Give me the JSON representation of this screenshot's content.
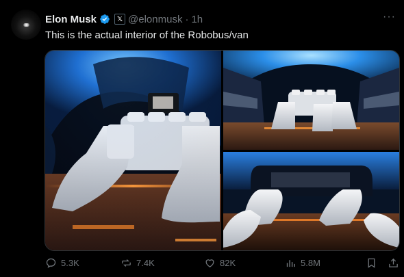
{
  "tweet": {
    "author": {
      "name": "Elon Musk",
      "handle": "@elonmusk",
      "x_badge": "𝕏",
      "separator": "·",
      "time": "1h"
    },
    "more": "···",
    "text": "This is the actual interior of the Robobus/van",
    "media": [
      {
        "name": "robobus-interior-wide"
      },
      {
        "name": "robobus-interior-rear"
      },
      {
        "name": "robobus-interior-front"
      }
    ],
    "actions": {
      "replies": "5.3K",
      "reposts": "7.4K",
      "likes": "82K",
      "views": "5.8M"
    }
  },
  "colors": {
    "background": "#000000",
    "text": "#e7e9ea",
    "muted": "#71767b",
    "verified": "#1d9bf0",
    "ambient_blue": "#3aa6ff",
    "ambient_orange": "#ff8a2a"
  }
}
